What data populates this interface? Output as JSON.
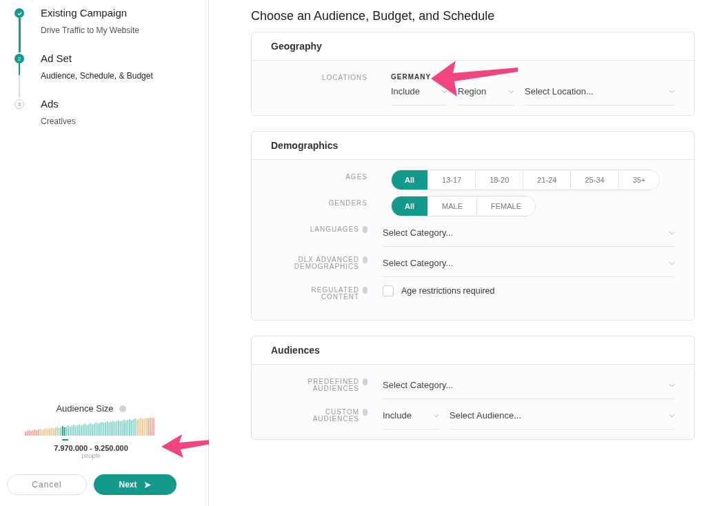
{
  "steps": [
    {
      "title": "Existing Campaign",
      "subtitle": "Drive Traffic to My Website",
      "done": true,
      "selected": false
    },
    {
      "number": "2",
      "title": "Ad Set",
      "subtitle": "Audience, Schedule, & Budget",
      "done": false,
      "selected": true
    },
    {
      "number": "3",
      "title": "Ads",
      "subtitle": "Creatives",
      "done": false,
      "selected": false
    }
  ],
  "audience_size": {
    "title": "Audience Size",
    "range": "7.970.000 - 9.250.000",
    "unit": "people"
  },
  "buttons": {
    "cancel": "Cancel",
    "next": "Next"
  },
  "page_title": "Choose an Audience, Budget, and Schedule",
  "sections": [
    {
      "title": "Geography",
      "rows": [
        {
          "kind": "location",
          "label": "LOCATIONS",
          "info": false,
          "value": "GERMANY",
          "selects": [
            {
              "value": "Include",
              "kind": "short"
            },
            {
              "value": "Region",
              "kind": "short"
            },
            {
              "placeholder": "Select Location...",
              "kind": "long"
            }
          ]
        }
      ]
    },
    {
      "title": "Demographics",
      "rows": [
        {
          "kind": "segmented",
          "label": "AGES",
          "info": false,
          "options": [
            {
              "label": "All",
              "selected": true
            },
            {
              "label": "13-17",
              "selected": false
            },
            {
              "label": "18-20",
              "selected": false
            },
            {
              "label": "21-24",
              "selected": false
            },
            {
              "label": "25-34",
              "selected": false
            },
            {
              "label": "35+",
              "selected": false
            }
          ]
        },
        {
          "kind": "segmented",
          "label": "GENDERS",
          "info": false,
          "options": [
            {
              "label": "All",
              "selected": true
            },
            {
              "label": "MALE",
              "selected": false
            },
            {
              "label": "FEMALE",
              "selected": false
            }
          ]
        },
        {
          "kind": "select",
          "label": "LANGUAGES",
          "info": true,
          "selects": [
            {
              "placeholder": "Select Category...",
              "kind": "long"
            }
          ]
        },
        {
          "kind": "select",
          "label": "DLX ADVANCED DEMOGRAPHICS",
          "info": true,
          "selects": [
            {
              "placeholder": "Select Category...",
              "kind": "long"
            }
          ]
        },
        {
          "kind": "checkbox",
          "label": "REGULATED CONTENT",
          "info": true,
          "text": "Age restrictions required",
          "checked": false
        }
      ]
    },
    {
      "title": "Audiences",
      "rows": [
        {
          "kind": "select",
          "label": "PREDEFINED AUDIENCES",
          "info": true,
          "selects": [
            {
              "placeholder": "Select Category...",
              "kind": "long"
            }
          ]
        },
        {
          "kind": "select",
          "label": "CUSTOM AUDIENCES",
          "info": true,
          "selects": [
            {
              "value": "Include",
              "kind": "short"
            },
            {
              "placeholder": "Select Audience...",
              "kind": "long"
            }
          ]
        }
      ]
    }
  ]
}
